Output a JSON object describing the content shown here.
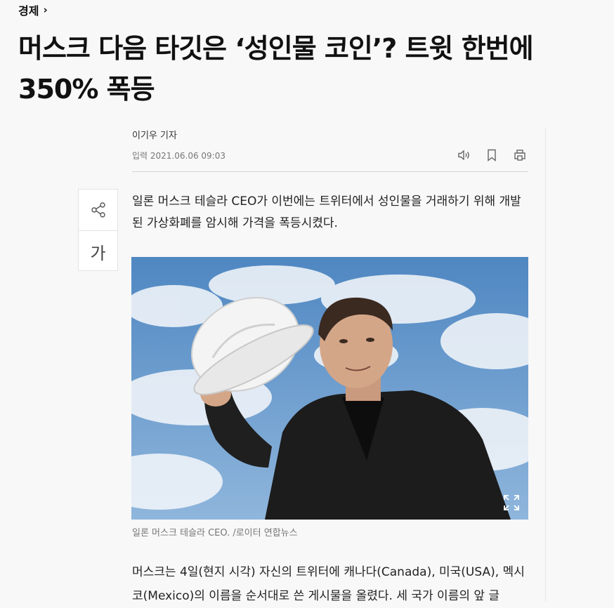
{
  "breadcrumb": {
    "section": "경제",
    "chevron": "›"
  },
  "headline": "머스크 다음 타깃은 ‘성인물 코인’? 트윗 한번에 350% 폭등",
  "byline": {
    "reporter": "이기우 기자",
    "date": "입력 2021.06.06 09:03"
  },
  "toolbar": {
    "icons": [
      "speaker-icon",
      "bookmark-icon",
      "print-icon"
    ]
  },
  "sidebar": {
    "share_icon": "share-icon",
    "font_size_label": "가"
  },
  "article": {
    "lead": "일론 머스크 테슬라 CEO가 이번에는 트위터에서 성인물을 거래하기 위해 개발된 가상화폐를 암시해 가격을 폭등시켰다.",
    "photo_caption": "일론 머스크 테슬라 CEO. /로이터 연합뉴스",
    "paragraph1": "머스크는 4일(현지 시각) 자신의 트위터에 캐나다(Canada), 미국(USA), 멕시코(Mexico)의 이름을 순서대로 쓴 게시물을 올렸다. 세 국가 이름의 앞 글"
  },
  "colors": {
    "background": "#f8f8f8",
    "text": "#111111",
    "muted": "#777777",
    "divider": "#d6d6d6"
  }
}
